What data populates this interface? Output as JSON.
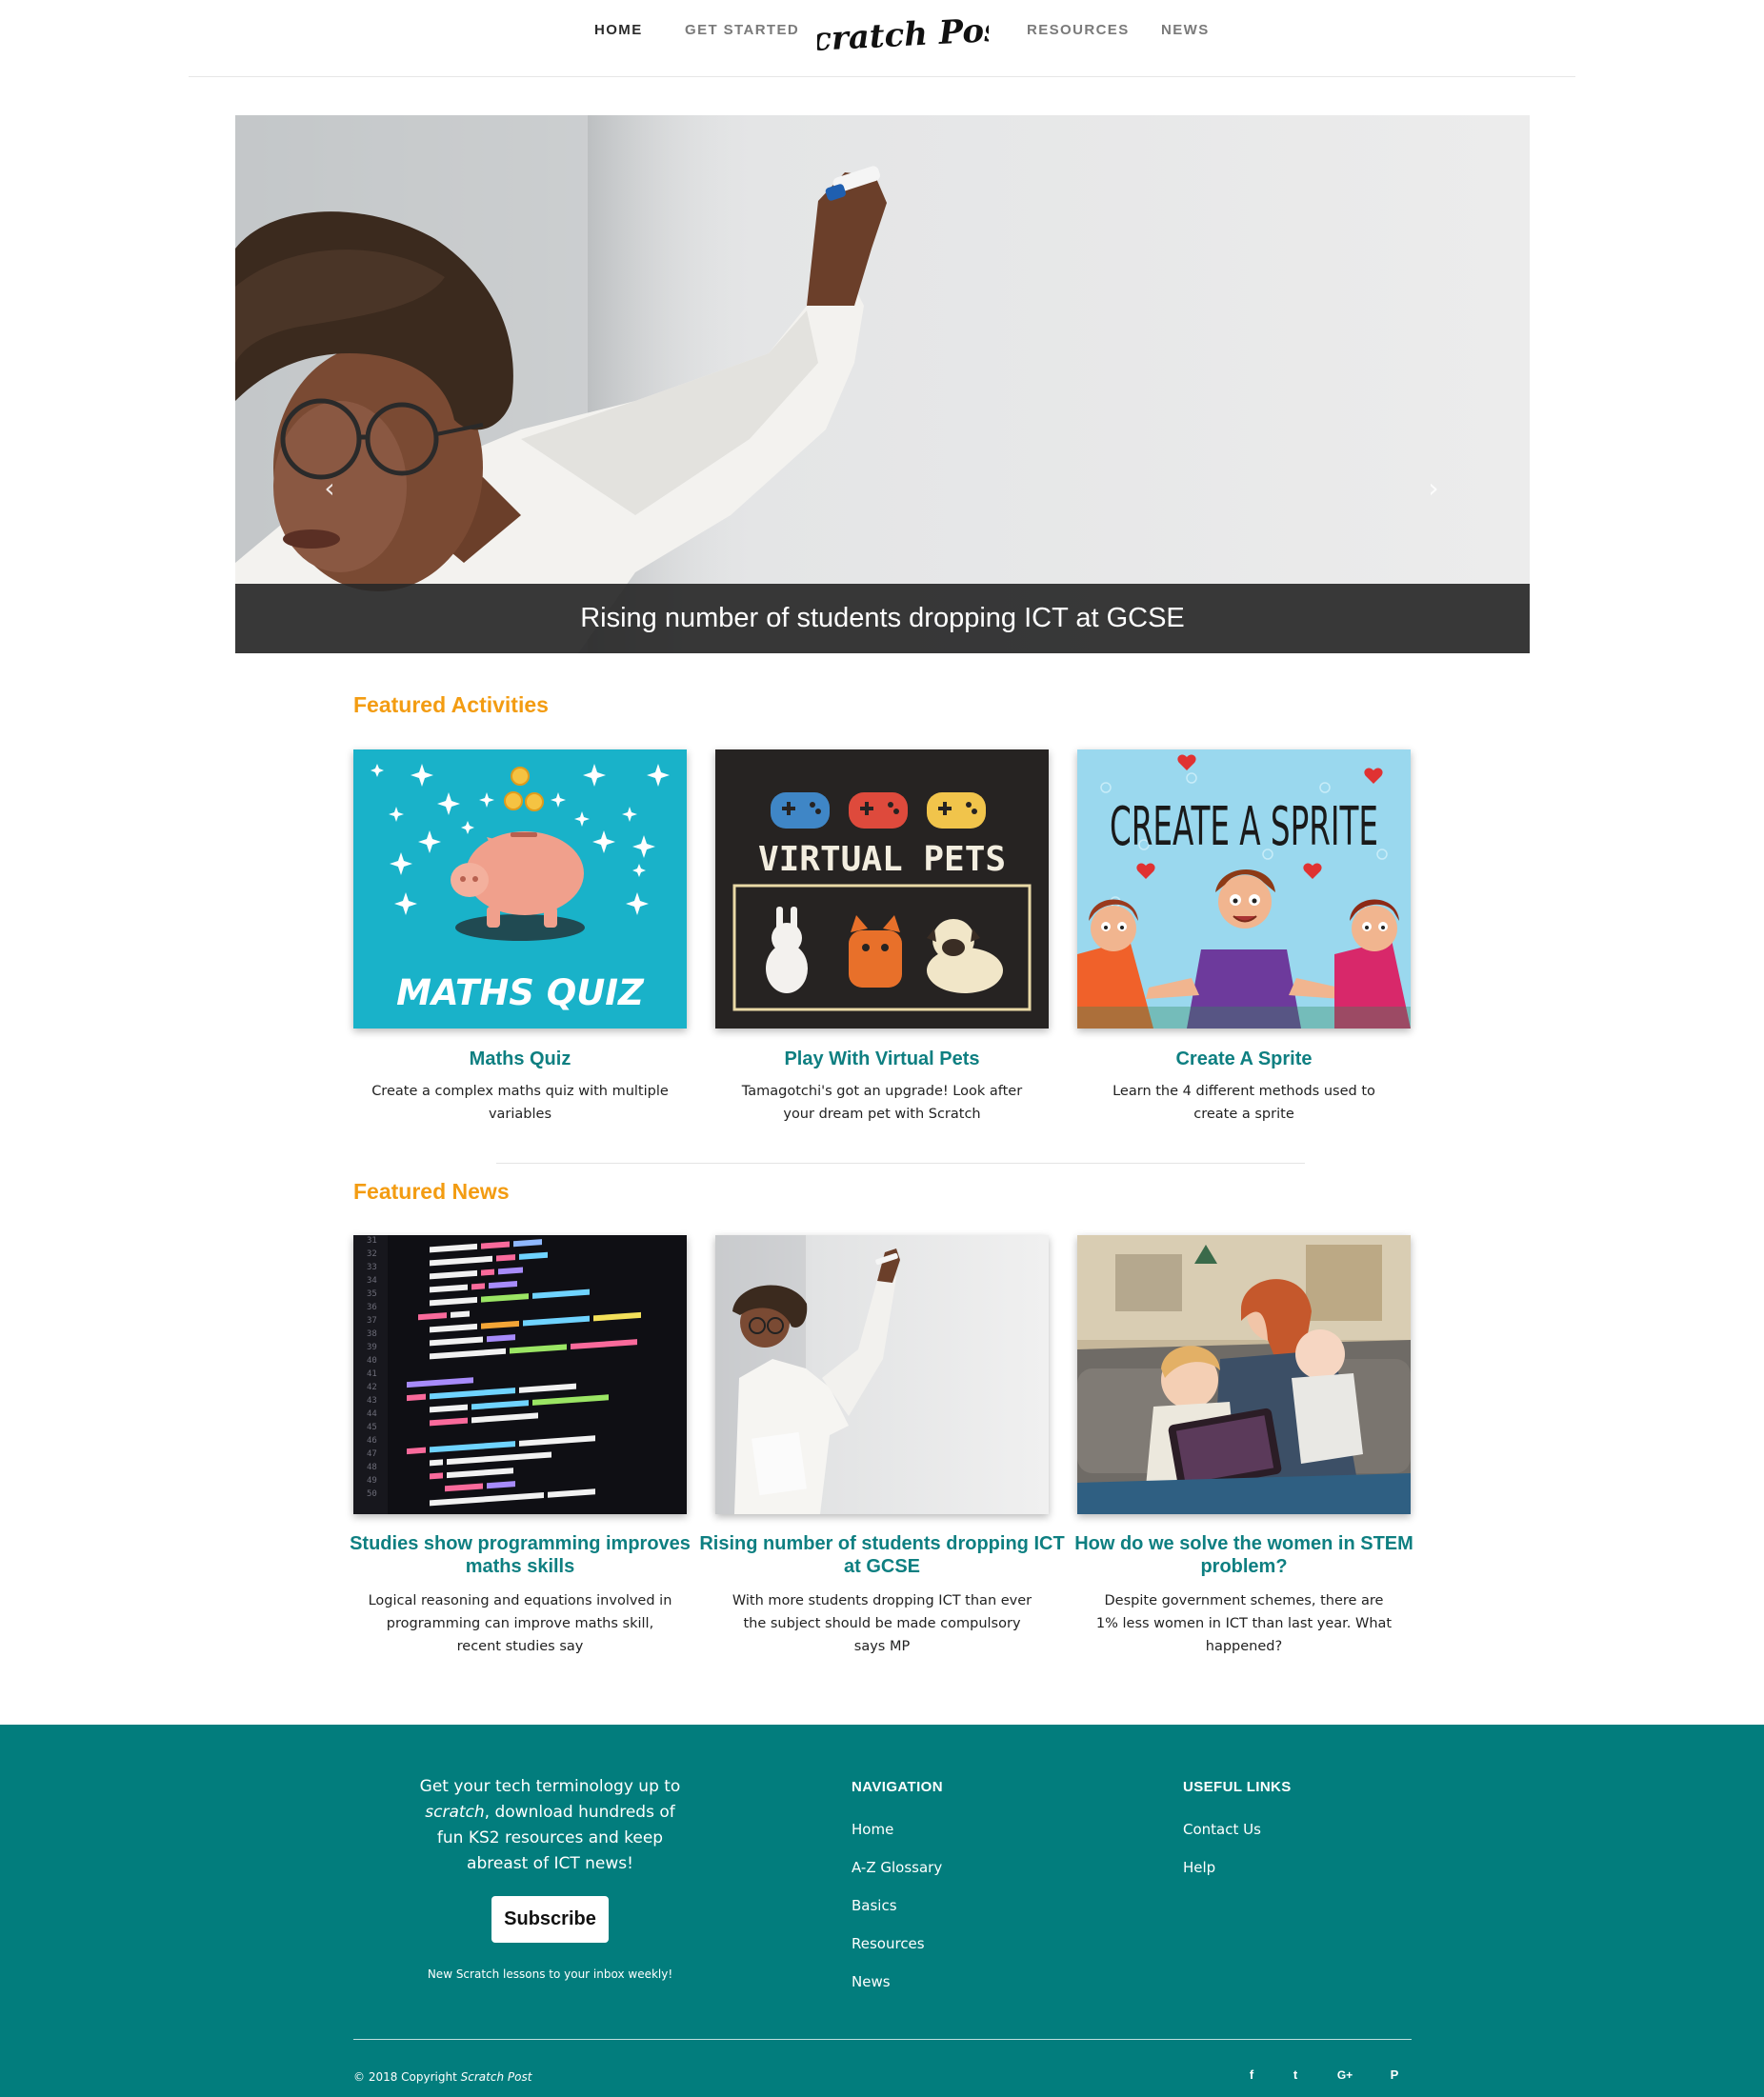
{
  "nav": {
    "home": "HOME",
    "get_started": "GET STARTED",
    "logo": "Scratch Post",
    "resources": "RESOURCES",
    "news": "NEWS"
  },
  "hero": {
    "caption": "Rising number of students dropping ICT at GCSE",
    "prev_icon": "chevron-left-icon",
    "next_icon": "chevron-right-icon",
    "slides_total": 3,
    "active_slide": 1
  },
  "featured_activities": {
    "title": "Featured Activities",
    "cards": [
      {
        "image_text": "MATHS QUIZ",
        "title": "Maths Quiz",
        "desc": "Create a complex maths quiz with multiple variables"
      },
      {
        "image_text": "VIRTUAL PETS",
        "title": "Play With Virtual Pets",
        "desc": "Tamagotchi's got an upgrade! Look after your dream pet with Scratch"
      },
      {
        "image_text": "CREATE A SPRITE",
        "title": "Create A Sprite",
        "desc": "Learn the 4 different methods used to create a sprite"
      }
    ]
  },
  "featured_news": {
    "title": "Featured News",
    "cards": [
      {
        "title": "Studies show programming improves maths skills",
        "desc": "Logical reasoning and equations involved in programming can improve maths skill, recent studies say"
      },
      {
        "title": "Rising number of students dropping ICT at GCSE",
        "desc": "With more students dropping ICT than ever the subject should be made compulsory says MP"
      },
      {
        "title": "How do we solve the women in STEM problem?",
        "desc": "Despite government schemes, there are 1% less women in ICT than last year. What happened?"
      }
    ]
  },
  "footer": {
    "blurb_1": "Get your tech terminology up to",
    "blurb_2_em": "scratch",
    "blurb_2_rest": ", download hundreds of",
    "blurb_3": "fun KS2 resources and keep",
    "blurb_4": "abreast of ICT news!",
    "subscribe_label": "Subscribe",
    "subscribe_note": "New Scratch lessons to your inbox weekly!",
    "navigation": {
      "heading": "NAVIGATION",
      "links": [
        "Home",
        "A-Z Glossary",
        "Basics",
        "Resources",
        "News"
      ]
    },
    "useful_links": {
      "heading": "USEFUL LINKS",
      "links": [
        "Contact Us",
        "Help"
      ]
    },
    "copyright_prefix": "© 2018 Copyright",
    "copyright_brand": "Scratch Post",
    "social": [
      {
        "icon": "facebook-icon",
        "glyph": "f"
      },
      {
        "icon": "twitter-icon",
        "glyph": "t"
      },
      {
        "icon": "google-plus-icon",
        "glyph": "G+"
      },
      {
        "icon": "pinterest-icon",
        "glyph": "P"
      }
    ]
  },
  "colors": {
    "accent_orange": "#f39c12",
    "teal": "#0e7f81",
    "footer_bg": "#027d7d"
  }
}
